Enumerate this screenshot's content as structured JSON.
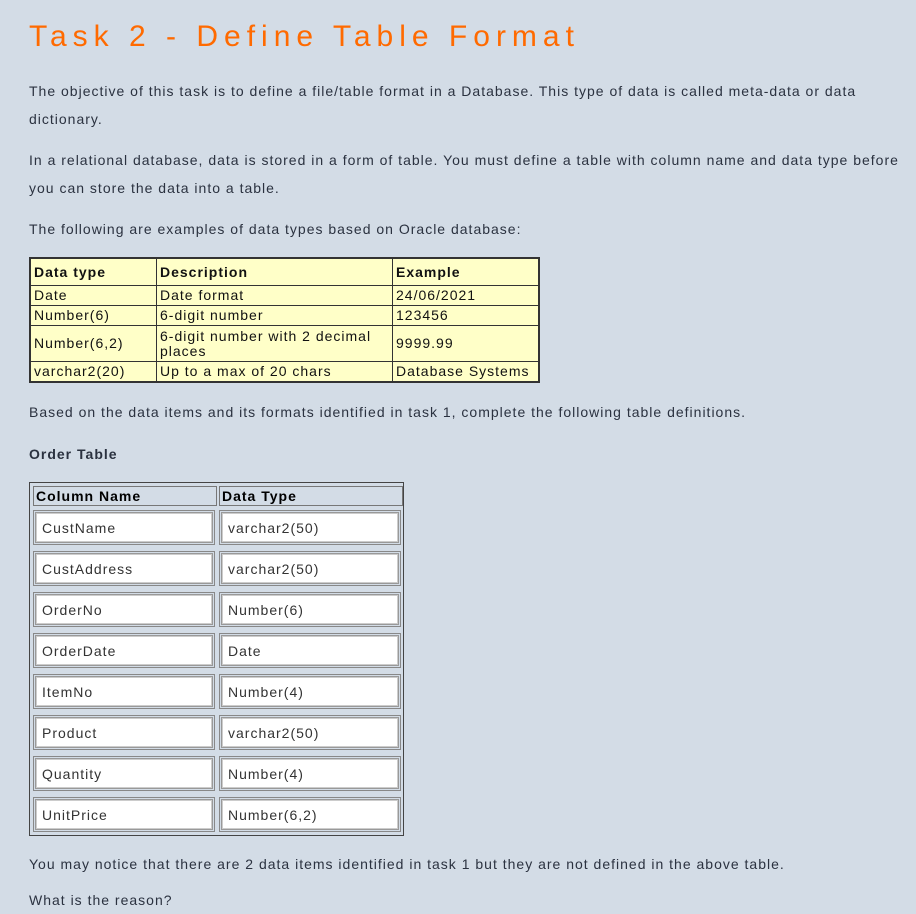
{
  "title": "Task 2 - Define Table Format",
  "paragraphs": {
    "p1": "The objective of this task is to define a file/table format in a Database. This type of data is called meta-data or data dictionary.",
    "p2": "In a relational database, data is stored in a form of table. You must define a table with column name and data type before you can store the data into a table.",
    "p3": "The following are examples of data types based on Oracle database:",
    "p4": "Based on the data items and its formats identified in task 1, complete the following table definitions.",
    "p5": "You may notice that there are 2 data items identified in task 1 but they are not defined in the above table.",
    "p6": "What is the reason?"
  },
  "types_table": {
    "headers": [
      "Data type",
      "Description",
      "Example"
    ],
    "rows": [
      [
        "Date",
        "Date format",
        "24/06/2021"
      ],
      [
        "Number(6)",
        "6-digit number",
        "123456"
      ],
      [
        "Number(6,2)",
        "6-digit number with 2 decimal places",
        "9999.99"
      ],
      [
        "varchar2(20)",
        "Up to a max of 20 chars",
        "Database Systems"
      ]
    ]
  },
  "order_table": {
    "title": "Order Table",
    "headers": [
      "Column Name",
      "Data Type"
    ],
    "rows": [
      [
        "CustName",
        "varchar2(50)"
      ],
      [
        "CustAddress",
        "varchar2(50)"
      ],
      [
        "OrderNo",
        "Number(6)"
      ],
      [
        "OrderDate",
        "Date"
      ],
      [
        "ItemNo",
        "Number(4)"
      ],
      [
        "Product",
        "varchar2(50)"
      ],
      [
        "Quantity",
        "Number(4)"
      ],
      [
        "UnitPrice",
        "Number(6,2)"
      ]
    ]
  },
  "colors": {
    "background": "#d3dce6",
    "title": "#ff6a00",
    "table_fill": "#ffffc8"
  }
}
